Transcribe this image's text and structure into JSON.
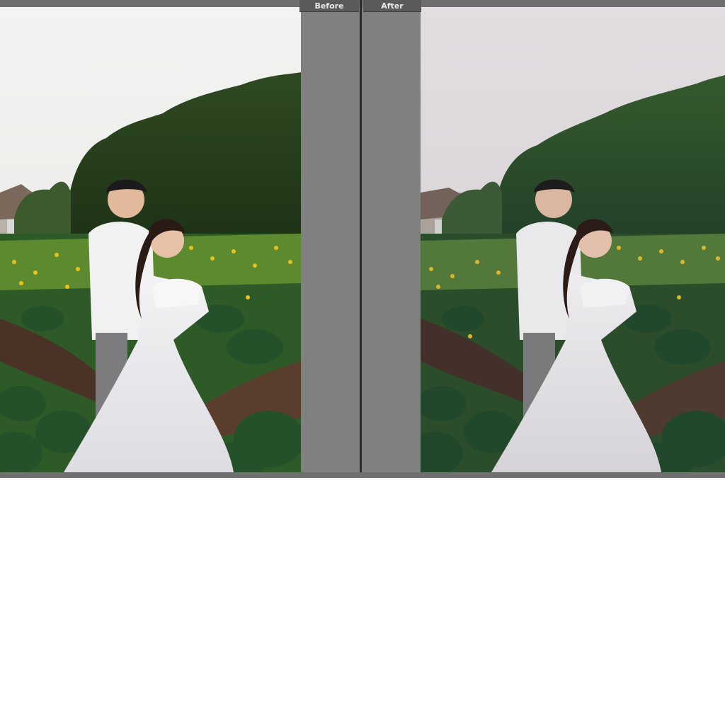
{
  "compare": {
    "before_label": "Before",
    "after_label": "After"
  },
  "panes": [
    {
      "id": "before",
      "image": "wedding-couple-in-flower-garden",
      "tone": "original"
    },
    {
      "id": "after",
      "image": "wedding-couple-in-flower-garden",
      "tone": "edited-muted"
    }
  ],
  "colors": {
    "panel_gray": "#808080",
    "label_bg": "#5a5a5a",
    "label_text": "#e9e9e9",
    "divider": "#2b2b2b"
  }
}
